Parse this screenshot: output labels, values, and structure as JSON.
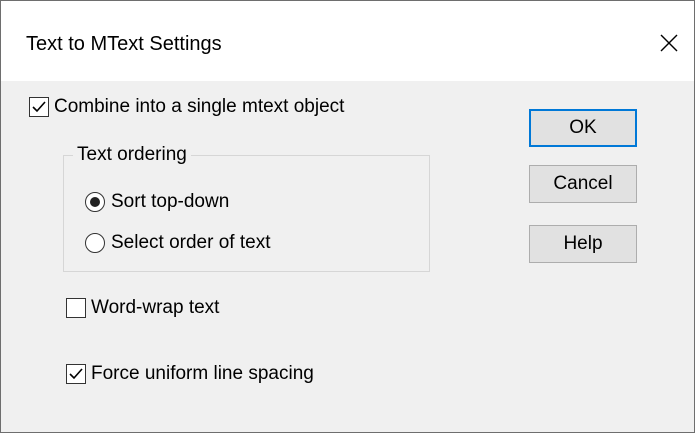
{
  "window": {
    "title": "Text to MText Settings",
    "close_icon": "close-icon"
  },
  "options": {
    "combine": {
      "label": "Combine into a single mtext object",
      "checked": true
    },
    "word_wrap": {
      "label": "Word-wrap text",
      "checked": false
    },
    "uniform_spacing": {
      "label": "Force uniform line spacing",
      "checked": true
    }
  },
  "text_ordering": {
    "title": "Text ordering",
    "options": [
      {
        "label": "Sort top-down",
        "selected": true
      },
      {
        "label": "Select order of text",
        "selected": false
      }
    ]
  },
  "buttons": {
    "ok": "OK",
    "cancel": "Cancel",
    "help": "Help"
  },
  "colors": {
    "accent": "#0078d7",
    "dialog_bg": "#f0f0f0",
    "button_bg": "#e1e1e1"
  }
}
